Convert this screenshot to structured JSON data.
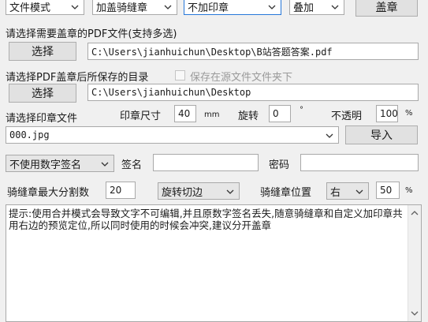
{
  "toolbar": {
    "mode_select": "文件模式",
    "seal_type_select": "加盖骑缝章",
    "stamp_select": "不加印章",
    "overlay_select": "叠加",
    "stamp_button": "盖章"
  },
  "source": {
    "label": "请选择需要盖章的PDF文件(支持多选)",
    "browse_button": "选择",
    "path": "C:\\Users\\jianhuichun\\Desktop\\B站答题答案.pdf"
  },
  "output": {
    "label": "请选择PDF盖章后所保存的目录",
    "same_folder_checkbox": "保存在源文件文件夹下",
    "same_folder_checked": false,
    "browse_button": "选择",
    "path": "C:\\Users\\jianhuichun\\Desktop"
  },
  "seal": {
    "label": "请选择印章文件",
    "size_label": "印章尺寸",
    "size_value": "40",
    "size_unit": "mm",
    "rotate_label": "旋转",
    "rotate_value": "0",
    "rotate_unit": "°",
    "opacity_label": "不透明",
    "opacity_value": "100",
    "opacity_unit": "%",
    "file_select": "000.jpg",
    "import_button": "导入"
  },
  "signature": {
    "select": "不使用数字签名",
    "name_label": "签名",
    "name_value": "",
    "password_label": "密码",
    "password_value": ""
  },
  "riding_seal": {
    "max_split_label": "骑缝章最大分割数",
    "max_split_value": "20",
    "cut_select": "旋转切边",
    "position_label": "骑缝章位置",
    "position_select": "右",
    "position_value": "50",
    "position_unit": "%"
  },
  "notice": "提示:使用合并模式会导致文字不可编辑,并且原数字签名丢失,随意骑缝章和自定义加印章共用右边的预览定位,所以同时使用的时候会冲突,建议分开盖章"
}
